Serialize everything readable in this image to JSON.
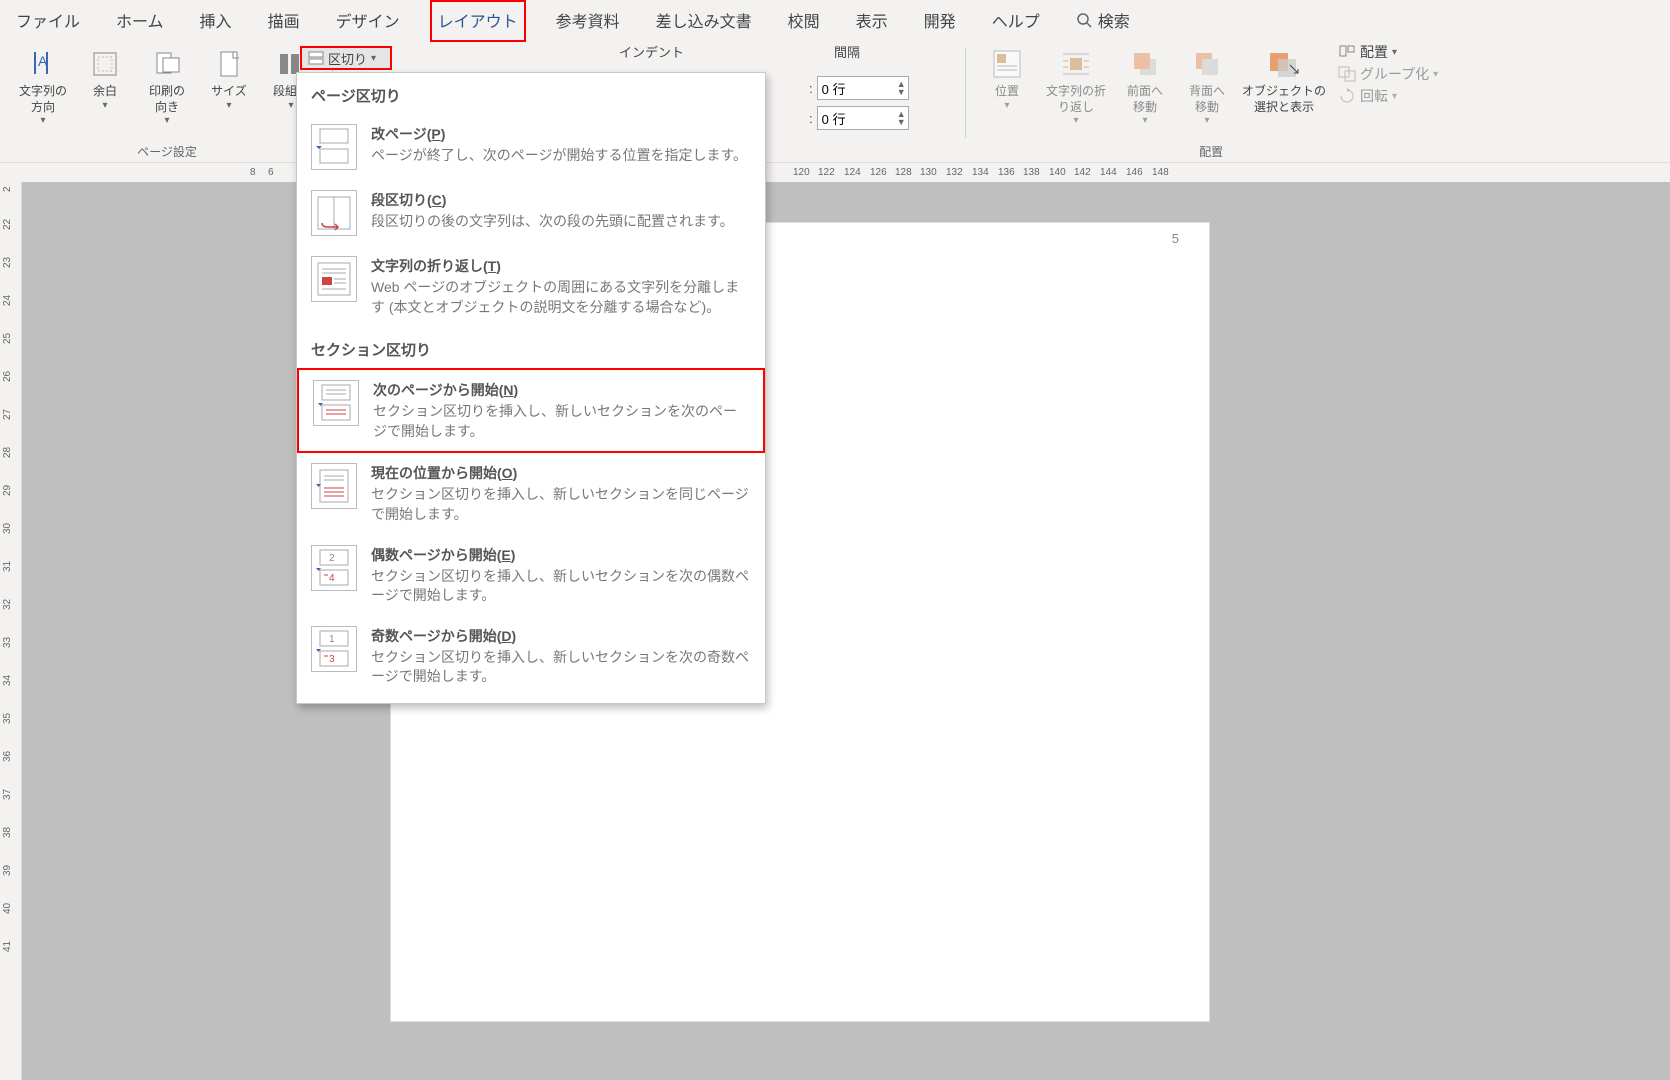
{
  "tabs": {
    "file": "ファイル",
    "home": "ホーム",
    "insert": "挿入",
    "draw": "描画",
    "design": "デザイン",
    "layout": "レイアウト",
    "references": "参考資料",
    "mailings": "差し込み文書",
    "review": "校閲",
    "view": "表示",
    "developer": "開発",
    "help": "ヘルプ",
    "search": "検索"
  },
  "page_setup": {
    "text_direction": "文字列の\n方向",
    "margins": "余白",
    "orientation": "印刷の\n向き",
    "size": "サイズ",
    "columns": "段組み",
    "group_label": "ページ設定",
    "breaks_button": "区切り"
  },
  "indent_spacing": {
    "indent": "インデント",
    "spacing": "間隔",
    "before_label": ":",
    "before_value": "0 行",
    "after_label": ":",
    "after_value": "0 行"
  },
  "arrange": {
    "position": "位置",
    "wrap": "文字列の折\nり返し",
    "forward": "前面へ\n移動",
    "backward": "背面へ\n移動",
    "select": "オブジェクトの\n選択と表示",
    "align": "配置",
    "group": "グループ化",
    "rotate": "回転",
    "group_label": "配置"
  },
  "breaks_menu": {
    "section1": "ページ区切り",
    "page_break_t": "改ページ(",
    "page_break_k": "P",
    "page_break_t2": ")",
    "page_break_d": "ページが終了し、次のページが開始する位置を指定します。",
    "col_break_t": "段区切り(",
    "col_break_k": "C",
    "col_break_t2": ")",
    "col_break_d": "段区切りの後の文字列は、次の段の先頭に配置されます。",
    "wrap_t": "文字列の折り返し(",
    "wrap_k": "T",
    "wrap_t2": ")",
    "wrap_d": "Web ページのオブジェクトの周囲にある文字列を分離します (本文とオブジェクトの説明文を分離する場合など)。",
    "section2": "セクション区切り",
    "next_t": "次のページから開始(",
    "next_k": "N",
    "next_t2": ")",
    "next_d": "セクション区切りを挿入し、新しいセクションを次のページで開始します。",
    "cont_t": "現在の位置から開始(",
    "cont_k": "O",
    "cont_t2": ")",
    "cont_d": "セクション区切りを挿入し、新しいセクションを同じページで開始します。",
    "even_t": "偶数ページから開始(",
    "even_k": "E",
    "even_t2": ")",
    "even_d": "セクション区切りを挿入し、新しいセクションを次の偶数ページで開始します。",
    "odd_t": "奇数ページから開始(",
    "odd_k": "D",
    "odd_t2": ")",
    "odd_d": "セクション区切りを挿入し、新しいセクションを次の奇数ページで開始します。"
  },
  "ruler_h": [
    "8",
    "6",
    "120",
    "122",
    "124",
    "126",
    "128",
    "130",
    "132",
    "134",
    "136",
    "138",
    "140",
    "142",
    "144",
    "146",
    "148"
  ],
  "ruler_h_pos": [
    250,
    268,
    793,
    818,
    844,
    870,
    895,
    920,
    946,
    972,
    998,
    1023,
    1049,
    1074,
    1100,
    1126,
    1152
  ],
  "ruler_v": [
    "2",
    "22",
    "23",
    "24",
    "25",
    "26",
    "27",
    "28",
    "29",
    "30",
    "31",
    "32",
    "33",
    "34",
    "35",
    "36",
    "37",
    "38",
    "39",
    "40",
    "41"
  ],
  "page": {
    "number": "5"
  }
}
